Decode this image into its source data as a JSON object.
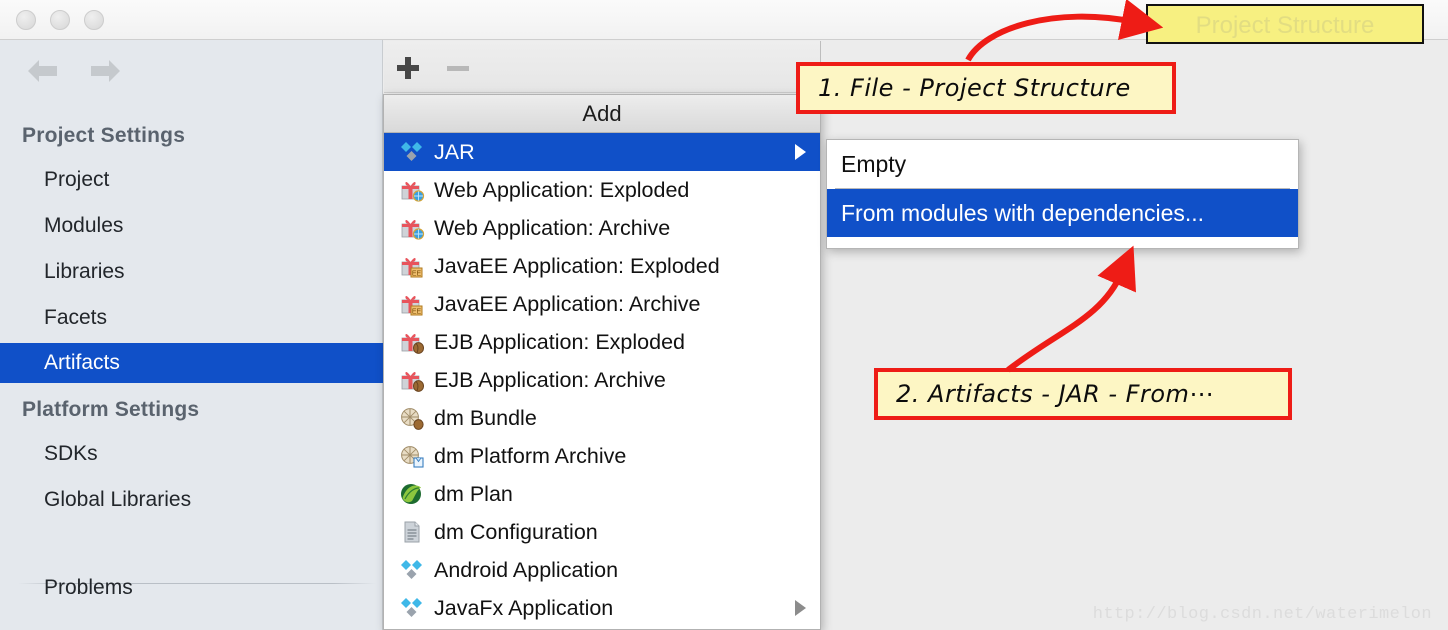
{
  "window": {
    "traffic_lights": [
      "close",
      "minimize",
      "zoom"
    ]
  },
  "sidebar": {
    "nav": {
      "back_icon": "arrow-left-icon",
      "forward_icon": "arrow-right-icon"
    },
    "groups": [
      {
        "label": "Project Settings",
        "items": [
          {
            "label": "Project",
            "selected": false
          },
          {
            "label": "Modules",
            "selected": false
          },
          {
            "label": "Libraries",
            "selected": false
          },
          {
            "label": "Facets",
            "selected": false
          },
          {
            "label": "Artifacts",
            "selected": true
          }
        ]
      },
      {
        "label": "Platform Settings",
        "items": [
          {
            "label": "SDKs",
            "selected": false
          },
          {
            "label": "Global Libraries",
            "selected": false
          }
        ]
      }
    ],
    "footer_item": {
      "label": "Problems"
    }
  },
  "toolbar": {
    "add_label": "+",
    "add_icon": "plus-icon",
    "remove_label": "–",
    "remove_icon": "minus-icon",
    "remove_disabled": true
  },
  "add_menu": {
    "header": "Add",
    "items": [
      {
        "label": "JAR",
        "icon": "diamond-cluster-icon",
        "selected": true,
        "has_submenu": true
      },
      {
        "label": "Web Application: Exploded",
        "icon": "gift-globe-icon",
        "selected": false,
        "has_submenu": false
      },
      {
        "label": "Web Application: Archive",
        "icon": "gift-globe-icon",
        "selected": false,
        "has_submenu": false
      },
      {
        "label": "JavaEE Application: Exploded",
        "icon": "gift-ee-icon",
        "selected": false,
        "has_submenu": false
      },
      {
        "label": "JavaEE Application: Archive",
        "icon": "gift-ee-icon",
        "selected": false,
        "has_submenu": false
      },
      {
        "label": "EJB Application: Exploded",
        "icon": "gift-bean-icon",
        "selected": false,
        "has_submenu": false
      },
      {
        "label": "EJB Application: Archive",
        "icon": "gift-bean-icon",
        "selected": false,
        "has_submenu": false
      },
      {
        "label": "dm Bundle",
        "icon": "bundle-icon",
        "selected": false,
        "has_submenu": false
      },
      {
        "label": "dm Platform Archive",
        "icon": "bundle-archive-icon",
        "selected": false,
        "has_submenu": false
      },
      {
        "label": "dm Plan",
        "icon": "green-leaf-icon",
        "selected": false,
        "has_submenu": false
      },
      {
        "label": "dm Configuration",
        "icon": "document-icon",
        "selected": false,
        "has_submenu": false
      },
      {
        "label": "Android Application",
        "icon": "diamond-cluster-icon",
        "selected": false,
        "has_submenu": false
      },
      {
        "label": "JavaFx Application",
        "icon": "diamond-cluster-icon",
        "selected": false,
        "has_submenu": true
      }
    ]
  },
  "submenu": {
    "items": [
      {
        "label": "Empty",
        "selected": false
      },
      {
        "label": "From modules with dependencies...",
        "selected": true
      }
    ]
  },
  "annotations": {
    "highlight_button": "Project Structure",
    "note1": "1. File - Project Structure",
    "note2": "2. Artifacts - JAR - From⋯"
  },
  "watermark": "http://blog.csdn.net/waterimelon",
  "colors": {
    "selection_blue": "#1050c8",
    "sidebar_bg": "#e4e8ed",
    "content_bg": "#ececec",
    "annotation_red": "#ee1c16",
    "note_bg": "#fdf6c4",
    "highlight_yellow": "#f7f081"
  }
}
